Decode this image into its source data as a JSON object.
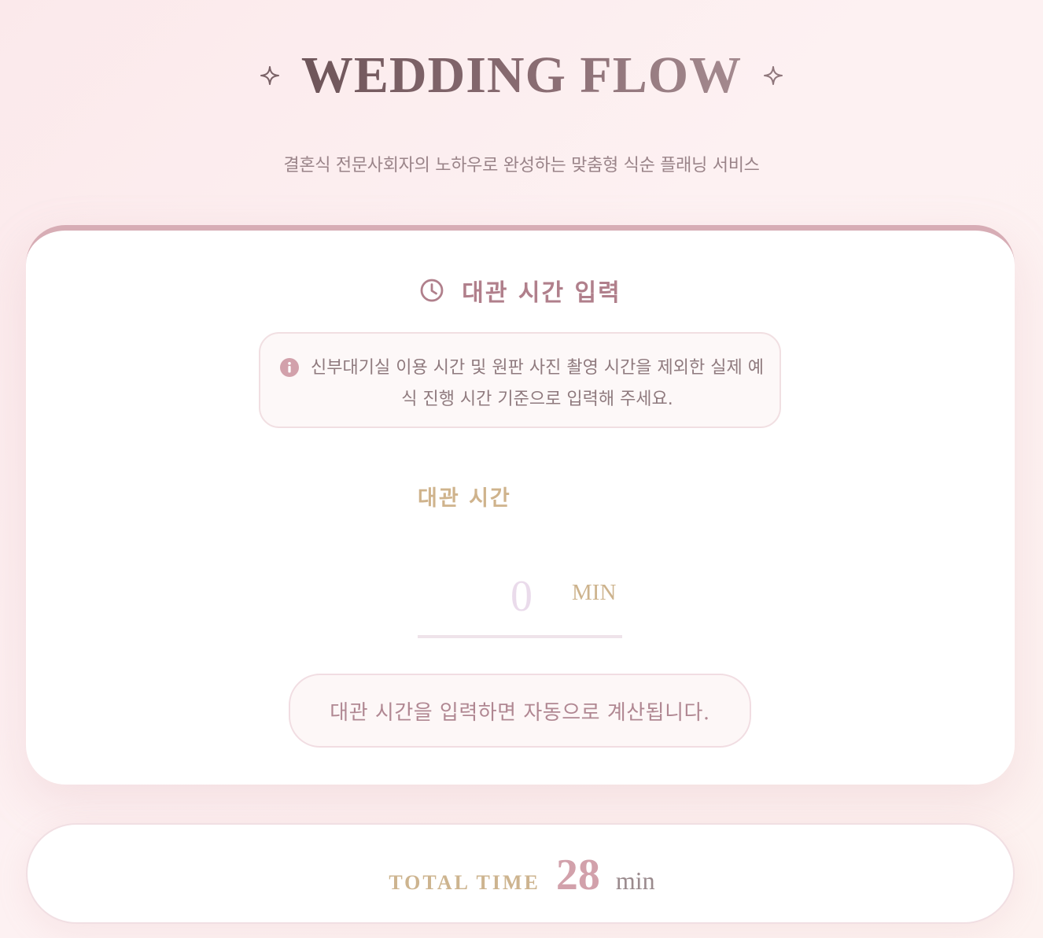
{
  "header": {
    "title": "WEDDING FLOW",
    "subtitle": "결혼식 전문사회자의 노하우로 완성하는 맞춤형 식순 플래닝 서비스"
  },
  "card": {
    "heading": "대관 시간 입력",
    "notice": "신부대기실 이용 시간 및 원판 사진 촬영 시간을 제외한 실제 예식 진행 시간 기준으로 입력해 주세요.",
    "field_label": "대관 시간",
    "input_placeholder": "0",
    "input_unit": "MIN",
    "auto_note": "대관 시간을 입력하면 자동으로 계산됩니다."
  },
  "total": {
    "label": "TOTAL TIME",
    "value": "28",
    "unit": "min"
  },
  "icons": {
    "title_left": "sparkle-icon",
    "title_right": "sparkle-icon",
    "heading": "clock-icon",
    "notice": "info-icon"
  },
  "colors": {
    "accent_rose": "#d7adb5",
    "accent_gold": "#cfb38c",
    "heading_rose": "#b07f8b",
    "title_dark": "#6e5559"
  }
}
